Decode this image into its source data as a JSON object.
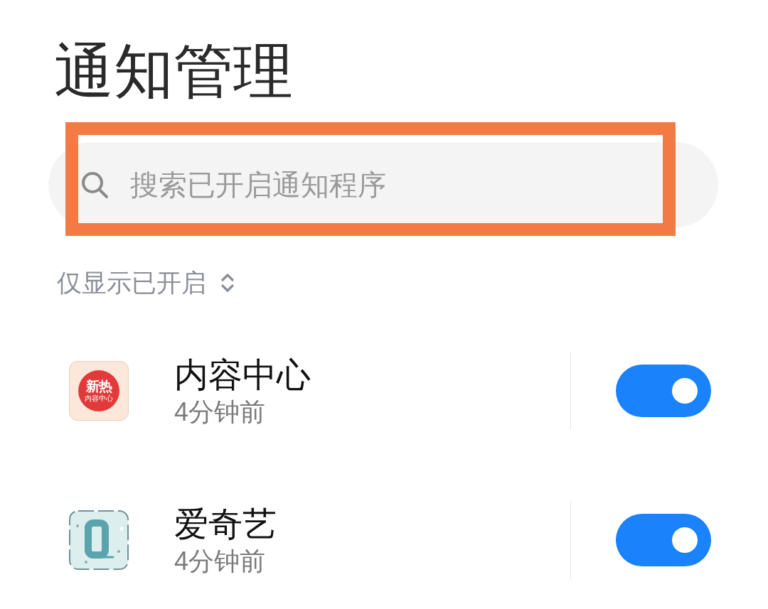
{
  "title": "通知管理",
  "search": {
    "placeholder": "搜索已开启通知程序",
    "highlighted": true
  },
  "filter": {
    "label": "仅显示已开启"
  },
  "apps": [
    {
      "name": "内容中心",
      "time": "4分钟前",
      "on": true,
      "icon": {
        "kind": "news-disc",
        "title": "新热",
        "caption": "内容中心"
      }
    },
    {
      "name": "爱奇艺",
      "time": "4分钟前",
      "on": true,
      "icon": {
        "kind": "q-frame"
      }
    }
  ]
}
